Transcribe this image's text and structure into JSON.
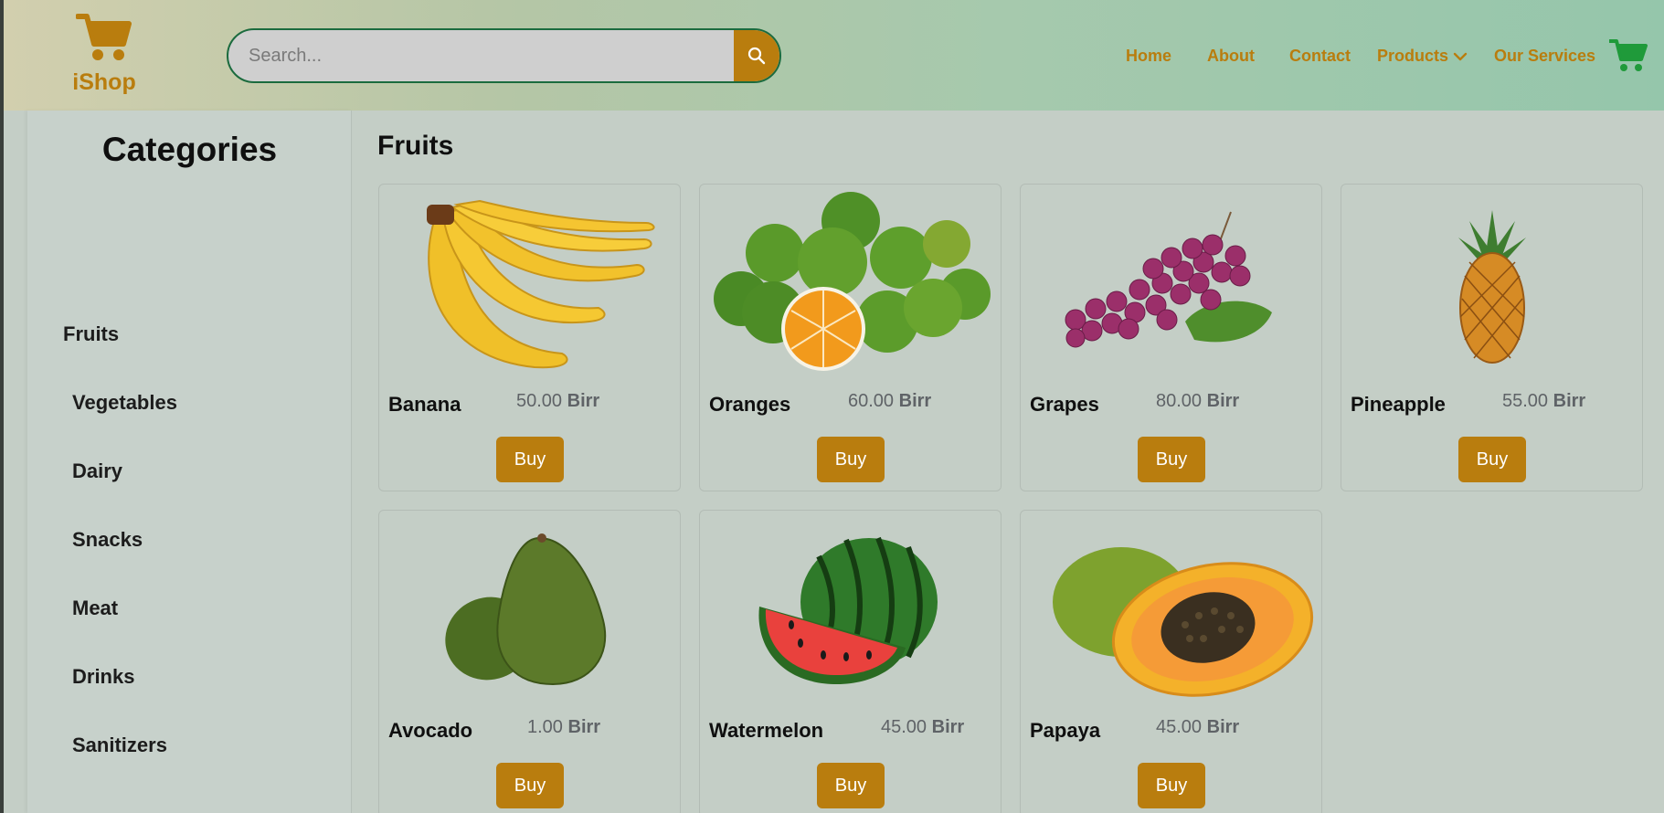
{
  "brand": {
    "name": "iShop",
    "logo_icon": "cart-icon"
  },
  "search": {
    "placeholder": "Search...",
    "button_icon": "search-icon"
  },
  "nav": {
    "home": "Home",
    "about": "About",
    "contact": "Contact",
    "products": "Products",
    "services": "Our Services",
    "cart_icon": "cart-icon"
  },
  "sidebar": {
    "title": "Categories",
    "items": [
      "Fruits",
      "Vegetables",
      "Dairy",
      "Snacks",
      "Meat",
      "Drinks",
      "Sanitizers"
    ]
  },
  "main": {
    "title": "Fruits",
    "currency": "Birr",
    "buy_label": "Buy",
    "products": [
      {
        "name": "Banana",
        "price": "50.00"
      },
      {
        "name": "Oranges",
        "price": "60.00"
      },
      {
        "name": "Grapes",
        "price": "80.00"
      },
      {
        "name": "Pineapple",
        "price": "55.00"
      },
      {
        "name": "Avocado",
        "price": "1.00"
      },
      {
        "name": "Watermelon",
        "price": "45.00"
      },
      {
        "name": "Papaya",
        "price": "45.00"
      }
    ]
  },
  "colors": {
    "accent": "#b97d0e",
    "search_border": "#1b6b3e",
    "nav_cart": "#1f9a3a"
  }
}
